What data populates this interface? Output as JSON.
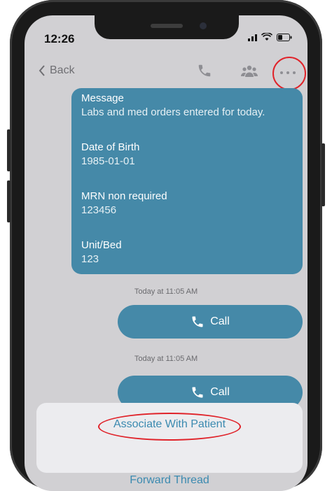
{
  "status_bar": {
    "time": "12:26"
  },
  "nav": {
    "back_label": "Back",
    "icons": [
      "phone-icon",
      "group-icon",
      "more-icon"
    ],
    "highlight_color": "#e0232a"
  },
  "message": {
    "bubble_color": "#4589a8",
    "fields": [
      {
        "label": "Message",
        "value": "Labs and med orders entered for today."
      },
      {
        "label": "Date of Birth",
        "value": "1985-01-01"
      },
      {
        "label": "MRN non required",
        "value": "123456"
      },
      {
        "label": "Unit/Bed",
        "value": "123"
      }
    ]
  },
  "call_events": [
    {
      "timestamp": "Today at 11:05 AM",
      "button_label": "Call"
    },
    {
      "timestamp": "Today at 11:05 AM",
      "button_label": "Call"
    }
  ],
  "action_sheet": {
    "items": [
      {
        "label": "Associate With Patient"
      },
      {
        "label": "Forward Thread"
      }
    ]
  }
}
